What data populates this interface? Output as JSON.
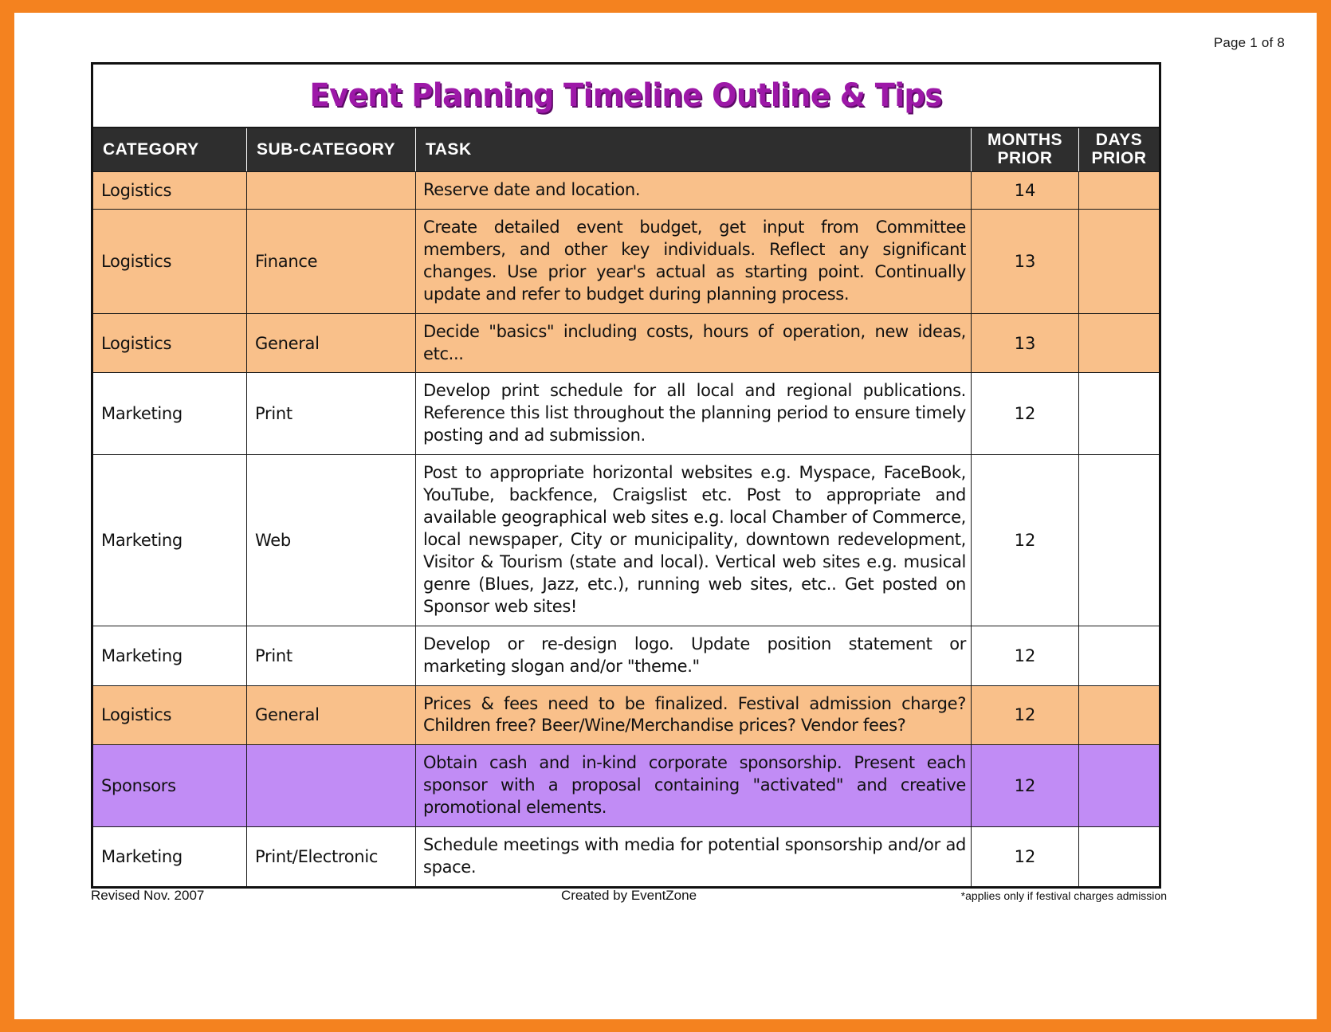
{
  "page": {
    "page_indicator": "Page 1 of 8",
    "border_color": "#f4821f"
  },
  "document": {
    "title": "Event Planning Timeline Outline & Tips",
    "title_color": "#9d18a8",
    "title_shadow_color": "#5c0a66"
  },
  "table": {
    "headers": {
      "category": "CATEGORY",
      "sub_category": "SUB-CATEGORY",
      "task": "TASK",
      "months_prior_line1": "MONTHS",
      "months_prior_line2": "PRIOR",
      "days_prior_line1": "DAYS",
      "days_prior_line2": "PRIOR"
    },
    "header_bg": "#2e2e2e",
    "header_fg": "#ffffff",
    "row_fills": {
      "orange": "#f9c08a",
      "white": "#ffffff",
      "purple": "#c18cf5"
    },
    "rows": [
      {
        "category": "Logistics",
        "sub_category": "",
        "task": "Reserve date and location.",
        "months_prior": "14",
        "days_prior": "",
        "fill": "orange"
      },
      {
        "category": "Logistics",
        "sub_category": "Finance",
        "task": "Create detailed event budget, get input from Committee members, and other key individuals.  Reflect any significant changes.  Use prior year's actual as starting point.  Continually update and refer to budget during planning process.",
        "months_prior": "13",
        "days_prior": "",
        "fill": "orange"
      },
      {
        "category": "Logistics",
        "sub_category": "General",
        "task": "Decide \"basics\" including costs, hours of operation, new ideas, etc...",
        "months_prior": "13",
        "days_prior": "",
        "fill": "orange"
      },
      {
        "category": "Marketing",
        "sub_category": "Print",
        "task": "Develop print schedule for all local and regional publications. Reference this list throughout the planning period to ensure timely posting and ad submission.",
        "months_prior": "12",
        "days_prior": "",
        "fill": "white"
      },
      {
        "category": "Marketing",
        "sub_category": "Web",
        "task": "Post to appropriate horizontal websites e.g. Myspace, FaceBook, YouTube, backfence, Craigslist etc.  Post to appropriate and available geographical web sites e.g. local Chamber of Commerce, local newspaper, City or municipality, downtown redevelopment, Visitor & Tourism (state and local).  Vertical web sites e.g. musical genre (Blues, Jazz, etc.), running web sites, etc..  Get posted on Sponsor web sites!",
        "months_prior": "12",
        "days_prior": "",
        "fill": "white"
      },
      {
        "category": "Marketing",
        "sub_category": "Print",
        "task": "Develop or re-design logo.  Update position statement or marketing slogan and/or \"theme.\"",
        "months_prior": "12",
        "days_prior": "",
        "fill": "white"
      },
      {
        "category": "Logistics",
        "sub_category": "General",
        "task": "Prices & fees need to be finalized.  Festival admission charge? Children free?  Beer/Wine/Merchandise prices? Vendor fees?",
        "months_prior": "12",
        "days_prior": "",
        "fill": "orange"
      },
      {
        "category": "Sponsors",
        "sub_category": "",
        "task": "Obtain cash and in-kind corporate sponsorship.  Present each sponsor with a proposal containing \"activated\" and creative promotional elements.",
        "months_prior": "12",
        "days_prior": "",
        "fill": "purple"
      },
      {
        "category": "Marketing",
        "sub_category": "Print/Electronic",
        "task": "Schedule meetings with media for potential sponsorship and/or ad space.",
        "months_prior": "12",
        "days_prior": "",
        "fill": "white"
      }
    ]
  },
  "footer": {
    "revised": "Revised Nov. 2007",
    "created_by": "Created by EventZone",
    "note": "*applies only if festival charges admission"
  }
}
